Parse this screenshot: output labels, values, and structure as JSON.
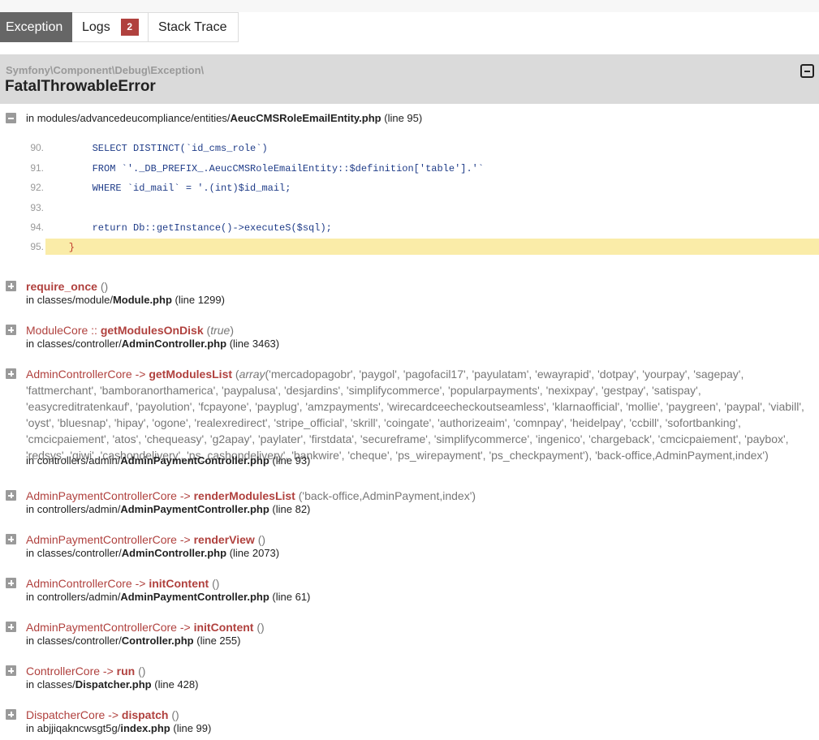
{
  "tabs": [
    {
      "label": "Exception",
      "active": true
    },
    {
      "label": "Logs",
      "badge": "2"
    },
    {
      "label": "Stack Trace"
    }
  ],
  "exception": {
    "namespace": "Symfony\\Component\\Debug\\Exception\\",
    "class": "FatalThrowableError"
  },
  "first_location": {
    "prefix": "in modules/advancedeucompliance/entities/",
    "file": "AeucCMSRoleEmailEntity.php",
    "line_text": "(line 95)"
  },
  "code_lines": [
    {
      "no": "90.",
      "src": "        SELECT DISTINCT(`id_cms_role`)"
    },
    {
      "no": "91.",
      "src": "        FROM `'._DB_PREFIX_.AeucCMSRoleEmailEntity::$definition['table'].'`"
    },
    {
      "no": "92.",
      "src": "        WHERE `id_mail` = '.(int)$id_mail;"
    },
    {
      "no": "93.",
      "src": ""
    },
    {
      "no": "94.",
      "src": "        return Db::getInstance()->executeS($sql);"
    },
    {
      "no": "95.",
      "src": "    }",
      "highlight": true
    }
  ],
  "frames": [
    {
      "class": "",
      "type": "",
      "function": "require_once",
      "args_open": " (",
      "args": "",
      "args_close": ")",
      "loc_prefix": "in classes/module/",
      "file": "Module.php",
      "line_text": "(line 1299)"
    },
    {
      "class": "ModuleCore",
      "type": " :: ",
      "function": "getModulesOnDisk",
      "args_open": " (",
      "args": "true",
      "args_close": ")",
      "args_italic": true,
      "loc_prefix": "in classes/controller/",
      "file": "AdminController.php",
      "line_text": "(line 3463)"
    },
    {
      "class": "AdminControllerCore",
      "type": " -> ",
      "function": "getModulesList",
      "args_open": " (",
      "args_italic_prefix": "array",
      "args": "('mercadopagobr', 'paygol', 'pagofacil17', 'payulatam', 'ewayrapid', 'dotpay', 'yourpay', 'sagepay', 'fattmerchant', 'bamboranorthamerica', 'paypalusa', 'desjardins', 'simplifycommerce', 'popularpayments', 'nexixpay', 'gestpay', 'satispay', 'easycreditratenkauf', 'payolution', 'fcpayone', 'payplug', 'amzpayments', 'wirecardceecheckoutseamless', 'klarnaofficial', 'mollie', 'paygreen', 'paypal', 'viabill', 'oyst', 'bluesnap', 'hipay', 'ogone', 'realexredirect', 'stripe_official', 'skrill', 'coingate', 'authorizeaim', 'comnpay', 'heidelpay', 'ccbill', 'sofortbanking', 'cmcicpaiement', 'atos', 'chequeasy', 'g2apay', 'paylater', 'firstdata', 'secureframe', 'simplifycommerce', 'ingenico', 'chargeback', 'cmcicpaiement', 'paybox', 'redsys', 'qiwi', 'cashondelivery', 'ps_cashondelivery', 'bankwire', 'cheque', 'ps_wirepayment', 'ps_checkpayment'), 'back-office,AdminPayment,index'",
      "args_close": ")",
      "loc_prefix": "in controllers/admin/",
      "file": "AdminPaymentController.php",
      "line_text": "(line 93)"
    },
    {
      "class": "AdminPaymentControllerCore",
      "type": " -> ",
      "function": "renderModulesList",
      "args_open": " (",
      "args": "'back-office,AdminPayment,index'",
      "args_close": ")",
      "loc_prefix": "in controllers/admin/",
      "file": "AdminPaymentController.php",
      "line_text": "(line 82)"
    },
    {
      "class": "AdminPaymentControllerCore",
      "type": " -> ",
      "function": "renderView",
      "args_open": " (",
      "args": "",
      "args_close": ")",
      "loc_prefix": "in classes/controller/",
      "file": "AdminController.php",
      "line_text": "(line 2073)"
    },
    {
      "class": "AdminControllerCore",
      "type": " -> ",
      "function": "initContent",
      "args_open": " (",
      "args": "",
      "args_close": ")",
      "loc_prefix": "in controllers/admin/",
      "file": "AdminPaymentController.php",
      "line_text": "(line 61)"
    },
    {
      "class": "AdminPaymentControllerCore",
      "type": " -> ",
      "function": "initContent",
      "args_open": " (",
      "args": "",
      "args_close": ")",
      "loc_prefix": "in classes/controller/",
      "file": "Controller.php",
      "line_text": "(line 255)"
    },
    {
      "class": "ControllerCore",
      "type": " -> ",
      "function": "run",
      "args_open": " (",
      "args": "",
      "args_close": ")",
      "loc_prefix": "in classes/",
      "file": "Dispatcher.php",
      "line_text": "(line 428)"
    },
    {
      "class": "DispatcherCore",
      "type": " -> ",
      "function": "dispatch",
      "args_open": " (",
      "args": "",
      "args_close": ")",
      "loc_prefix": "in abjjiqakncwsgt5g/",
      "file": "index.php",
      "line_text": "(line 99)"
    }
  ]
}
